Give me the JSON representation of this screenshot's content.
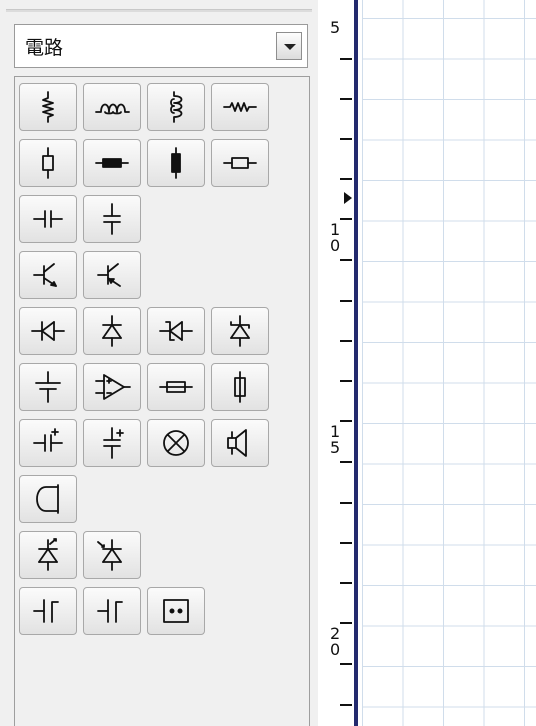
{
  "palette": {
    "category_select": {
      "value": "電路"
    },
    "rows": [
      [
        "resistor-vertical-zigzag",
        "inductor-horizontal",
        "inductor-vertical",
        "resistor-horizontal-zigzag"
      ],
      [
        "resistor-box-vertical",
        "resistor-filled-horizontal",
        "resistor-filled-vertical",
        "resistor-box-horizontal"
      ],
      [
        "capacitor-horizontal",
        "capacitor-vertical"
      ],
      [
        "transistor-npn",
        "transistor-pnp"
      ],
      [
        "diode-horizontal",
        "diode-vertical",
        "zener-diode-horizontal",
        "zener-diode-vertical"
      ],
      [
        "ground",
        "op-amp",
        "fuse-horizontal",
        "fuse-vertical"
      ],
      [
        "polar-capacitor-horizontal",
        "polar-capacitor-vertical",
        "lamp",
        "speaker"
      ],
      [
        "coil-loop"
      ],
      [
        "led-vertical",
        "photodiode-vertical"
      ],
      [
        "switch-horizontal",
        "switch-horizontal-alt",
        "socket"
      ]
    ]
  },
  "ruler": {
    "labels": [
      {
        "digits": [
          "5"
        ]
      },
      {
        "digits": [
          "1",
          "0"
        ]
      },
      {
        "digits": [
          "1",
          "5"
        ]
      },
      {
        "digits": [
          "2",
          "0"
        ]
      }
    ]
  }
}
